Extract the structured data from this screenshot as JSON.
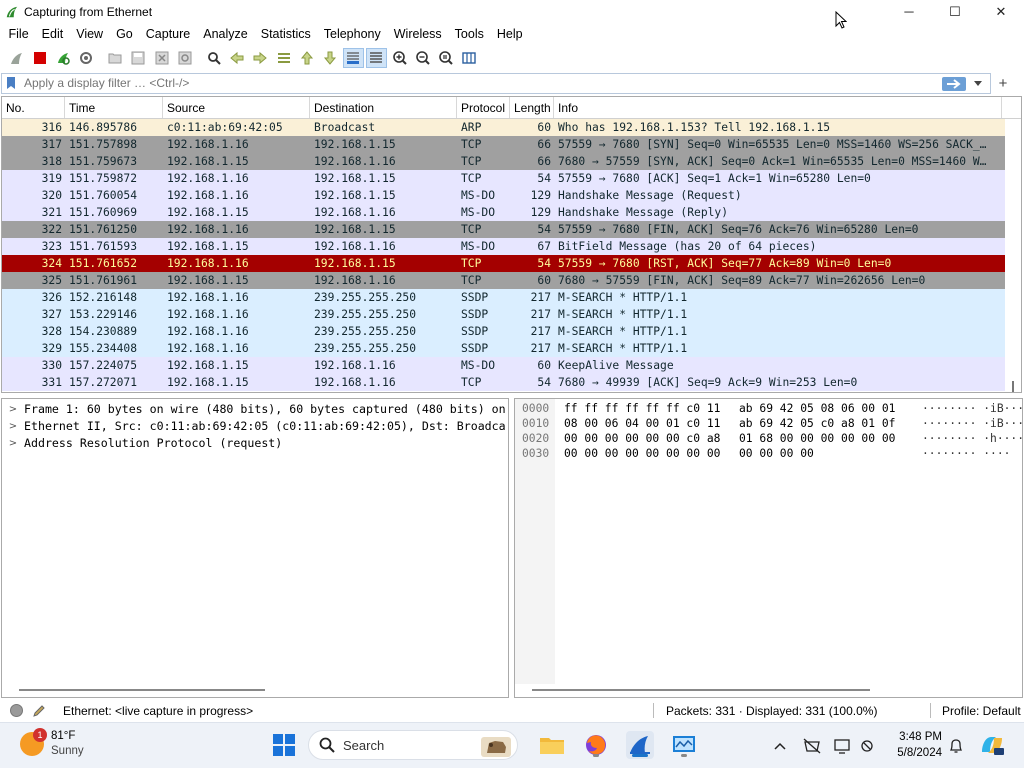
{
  "window": {
    "title": "Capturing from Ethernet",
    "controls": {
      "minimize": "─",
      "maximize": "☐",
      "close": "✕"
    }
  },
  "menu": [
    "File",
    "Edit",
    "View",
    "Go",
    "Capture",
    "Analyze",
    "Statistics",
    "Telephony",
    "Wireless",
    "Tools",
    "Help"
  ],
  "toolbar": {
    "icons": [
      "shark-fin-start-icon",
      "stop-capture-icon",
      "restart-capture-icon",
      "capture-options-icon",
      "open-file-icon",
      "save-file-icon",
      "close-file-icon",
      "reload-file-icon",
      "find-packet-icon",
      "go-back-icon",
      "go-forward-icon",
      "go-to-packet-icon",
      "go-first-icon",
      "go-last-icon",
      "autoscroll-icon",
      "colorize-icon",
      "zoom-in-icon",
      "zoom-out-icon",
      "zoom-normal-icon",
      "resize-columns-icon"
    ]
  },
  "filter": {
    "placeholder": "Apply a display filter … <Ctrl-/>",
    "value": ""
  },
  "packet_list": {
    "columns": [
      "No.",
      "Time",
      "Source",
      "Destination",
      "Protocol",
      "Length",
      "Info"
    ],
    "rows": [
      {
        "no": "316",
        "time": "146.895786",
        "src": "c0:11:ab:69:42:05",
        "dst": "Broadcast",
        "proto": "ARP",
        "len": "60",
        "info": "Who has 192.168.1.153? Tell 192.168.1.15",
        "bg": "#faf0d7",
        "fg": "#12272e"
      },
      {
        "no": "317",
        "time": "151.757898",
        "src": "192.168.1.16",
        "dst": "192.168.1.15",
        "proto": "TCP",
        "len": "66",
        "info": "57559 → 7680 [SYN] Seq=0 Win=65535 Len=0 MSS=1460 WS=256 SACK_…",
        "bg": "#a0a0a0",
        "fg": "#12272e"
      },
      {
        "no": "318",
        "time": "151.759673",
        "src": "192.168.1.15",
        "dst": "192.168.1.16",
        "proto": "TCP",
        "len": "66",
        "info": "7680 → 57559 [SYN, ACK] Seq=0 Ack=1 Win=65535 Len=0 MSS=1460 W…",
        "bg": "#a0a0a0",
        "fg": "#12272e"
      },
      {
        "no": "319",
        "time": "151.759872",
        "src": "192.168.1.16",
        "dst": "192.168.1.15",
        "proto": "TCP",
        "len": "54",
        "info": "57559 → 7680 [ACK] Seq=1 Ack=1 Win=65280 Len=0",
        "bg": "#e7e6ff",
        "fg": "#12272e"
      },
      {
        "no": "320",
        "time": "151.760054",
        "src": "192.168.1.16",
        "dst": "192.168.1.15",
        "proto": "MS-DO",
        "len": "129",
        "info": "Handshake Message (Request)",
        "bg": "#e7e6ff",
        "fg": "#12272e"
      },
      {
        "no": "321",
        "time": "151.760969",
        "src": "192.168.1.15",
        "dst": "192.168.1.16",
        "proto": "MS-DO",
        "len": "129",
        "info": "Handshake Message (Reply)",
        "bg": "#e7e6ff",
        "fg": "#12272e"
      },
      {
        "no": "322",
        "time": "151.761250",
        "src": "192.168.1.16",
        "dst": "192.168.1.15",
        "proto": "TCP",
        "len": "54",
        "info": "57559 → 7680 [FIN, ACK] Seq=76 Ack=76 Win=65280 Len=0",
        "bg": "#a0a0a0",
        "fg": "#12272e"
      },
      {
        "no": "323",
        "time": "151.761593",
        "src": "192.168.1.15",
        "dst": "192.168.1.16",
        "proto": "MS-DO",
        "len": "67",
        "info": "BitField Message (has 20 of 64 pieces)",
        "bg": "#e7e6ff",
        "fg": "#12272e"
      },
      {
        "no": "324",
        "time": "151.761652",
        "src": "192.168.1.16",
        "dst": "192.168.1.15",
        "proto": "TCP",
        "len": "54",
        "info": "57559 → 7680 [RST, ACK] Seq=77 Ack=89 Win=0 Len=0",
        "bg": "#a40000",
        "fg": "#fffc9c"
      },
      {
        "no": "325",
        "time": "151.761961",
        "src": "192.168.1.15",
        "dst": "192.168.1.16",
        "proto": "TCP",
        "len": "60",
        "info": "7680 → 57559 [FIN, ACK] Seq=89 Ack=77 Win=262656 Len=0",
        "bg": "#a0a0a0",
        "fg": "#12272e"
      },
      {
        "no": "326",
        "time": "152.216148",
        "src": "192.168.1.16",
        "dst": "239.255.255.250",
        "proto": "SSDP",
        "len": "217",
        "info": "M-SEARCH * HTTP/1.1",
        "bg": "#daeeff",
        "fg": "#12272e"
      },
      {
        "no": "327",
        "time": "153.229146",
        "src": "192.168.1.16",
        "dst": "239.255.255.250",
        "proto": "SSDP",
        "len": "217",
        "info": "M-SEARCH * HTTP/1.1",
        "bg": "#daeeff",
        "fg": "#12272e"
      },
      {
        "no": "328",
        "time": "154.230889",
        "src": "192.168.1.16",
        "dst": "239.255.255.250",
        "proto": "SSDP",
        "len": "217",
        "info": "M-SEARCH * HTTP/1.1",
        "bg": "#daeeff",
        "fg": "#12272e"
      },
      {
        "no": "329",
        "time": "155.234408",
        "src": "192.168.1.16",
        "dst": "239.255.255.250",
        "proto": "SSDP",
        "len": "217",
        "info": "M-SEARCH * HTTP/1.1",
        "bg": "#daeeff",
        "fg": "#12272e"
      },
      {
        "no": "330",
        "time": "157.224075",
        "src": "192.168.1.15",
        "dst": "192.168.1.16",
        "proto": "MS-DO",
        "len": "60",
        "info": "KeepAlive Message",
        "bg": "#e7e6ff",
        "fg": "#12272e"
      },
      {
        "no": "331",
        "time": "157.272071",
        "src": "192.168.1.15",
        "dst": "192.168.1.16",
        "proto": "TCP",
        "len": "54",
        "info": "7680 → 49939 [ACK] Seq=9 Ack=9 Win=253 Len=0",
        "bg": "#e7e6ff",
        "fg": "#12272e"
      }
    ]
  },
  "details": [
    "Frame 1: 60 bytes on wire (480 bits), 60 bytes captured (480 bits) on",
    "Ethernet II, Src: c0:11:ab:69:42:05 (c0:11:ab:69:42:05), Dst: Broadca",
    "Address Resolution Protocol (request)"
  ],
  "bytes": [
    {
      "offset": "0000",
      "hex1": "ff ff ff ff ff ff c0 11",
      "hex2": "ab 69 42 05 08 06 00 01",
      "ascii": "········ ·iB·····"
    },
    {
      "offset": "0010",
      "hex1": "08 00 06 04 00 01 c0 11",
      "hex2": "ab 69 42 05 c0 a8 01 0f",
      "ascii": "········ ·iB·····"
    },
    {
      "offset": "0020",
      "hex1": "00 00 00 00 00 00 c0 a8",
      "hex2": "01 68 00 00 00 00 00 00",
      "ascii": "········ ·h······"
    },
    {
      "offset": "0030",
      "hex1": "00 00 00 00 00 00 00 00",
      "hex2": "00 00 00 00",
      "ascii": "········ ····"
    }
  ],
  "status": {
    "capture": "Ethernet: <live capture in progress>",
    "packets": "Packets: 331 · Displayed: 331 (100.0%)",
    "profile": "Profile: Default"
  },
  "taskbar": {
    "weather_temp": "81°F",
    "weather_desc": "Sunny",
    "weather_badge": "1",
    "search": "Search",
    "time": "3:48 PM",
    "date": "5/8/2024"
  }
}
